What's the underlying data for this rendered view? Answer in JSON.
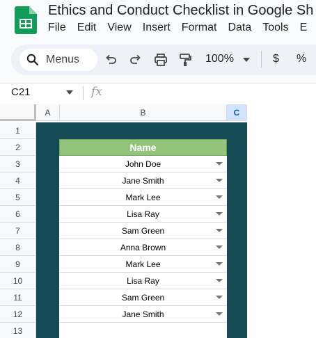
{
  "app": {
    "title": "Ethics and Conduct Checklist in Google Sh",
    "menus": [
      "File",
      "Edit",
      "View",
      "Insert",
      "Format",
      "Data",
      "Tools",
      "E"
    ]
  },
  "toolbar": {
    "search_label": "Menus",
    "zoom": "100%",
    "currency": "$",
    "percent": "%"
  },
  "formula_bar": {
    "cell_ref": "C21",
    "fx": "fx"
  },
  "grid": {
    "columns": [
      "A",
      "B",
      "C"
    ],
    "selected_column": "C",
    "rows": [
      "1",
      "2",
      "3",
      "4",
      "5",
      "6",
      "7",
      "8",
      "9",
      "10",
      "11",
      "12",
      "13"
    ]
  },
  "table": {
    "header": "Name",
    "names": [
      "John Doe",
      "Jane Smith",
      "Mark Lee",
      "Lisa Ray",
      "Sam Green",
      "Anna Brown",
      "Mark Lee",
      "Lisa Ray",
      "Sam Green",
      "Jane Smith"
    ]
  },
  "colors": {
    "teal_background": "#164b55",
    "header_green": "#93c47d",
    "selected_column": "#d3e3fd"
  }
}
